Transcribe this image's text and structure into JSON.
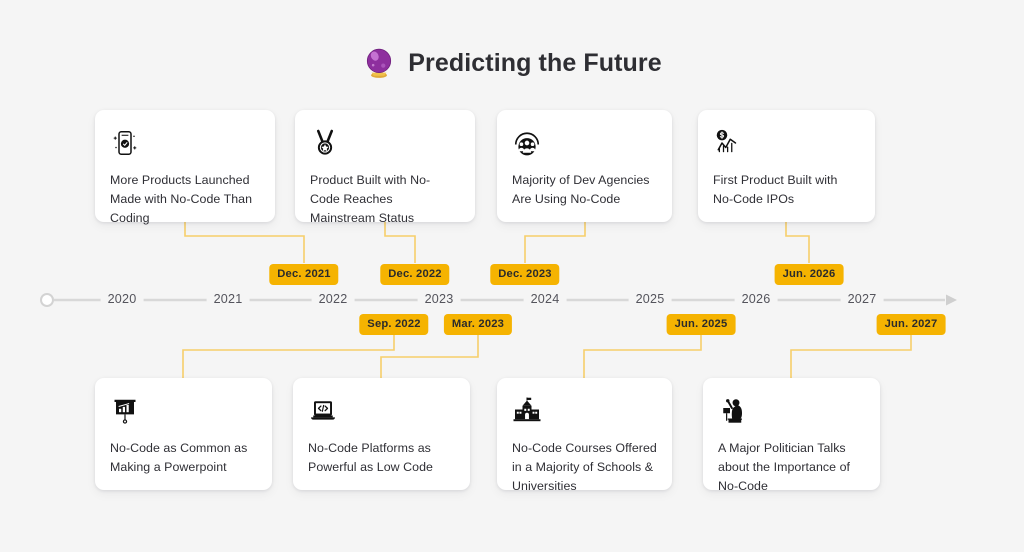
{
  "header": {
    "title": "Predicting the Future",
    "icon": "crystal-ball-icon"
  },
  "theme": {
    "background": "#f5f5f5",
    "card_background": "#ffffff",
    "badge_background": "#f5b301",
    "badge_text": "#2b2b2b",
    "connector": "#f7cf6a",
    "axis": "#d8d8d8",
    "title_text": "#2e2e33",
    "card_text": "#2f2f35",
    "year_text": "#54545c"
  },
  "timeline": {
    "years": [
      "2020",
      "2021",
      "2022",
      "2023",
      "2024",
      "2025",
      "2026",
      "2027"
    ],
    "start_marker": "circle",
    "end_marker": "arrow"
  },
  "events_top": [
    {
      "icon": "mobile-phone-icon",
      "text": "More Products Launched Made with No-Code Than Coding",
      "date": "Dec. 2021"
    },
    {
      "icon": "medal-icon",
      "text": "Product Built with No-Code Reaches Mainstream Status",
      "date": "Dec. 2022"
    },
    {
      "icon": "people-group-icon",
      "text": "Majority of Dev Agencies Are Using No-Code",
      "date": "Dec. 2023"
    },
    {
      "icon": "dollar-chart-icon",
      "text": "First Product Built with No-Code IPOs",
      "date": "Jun. 2026"
    }
  ],
  "events_bottom": [
    {
      "icon": "presentation-chart-icon",
      "text": "No-Code as Common as Making a Powerpoint",
      "date": "Sep. 2022"
    },
    {
      "icon": "laptop-code-icon",
      "text": "No-Code Platforms as Powerful as Low Code",
      "date": "Mar. 2023"
    },
    {
      "icon": "school-building-icon",
      "text": "No-Code Courses Offered in a Majority of Schools & Universities",
      "date": "Jun. 2025"
    },
    {
      "icon": "politician-speaker-icon",
      "text": "A Major Politician Talks about the Importance of No-Code",
      "date": "Jun. 2027"
    }
  ]
}
